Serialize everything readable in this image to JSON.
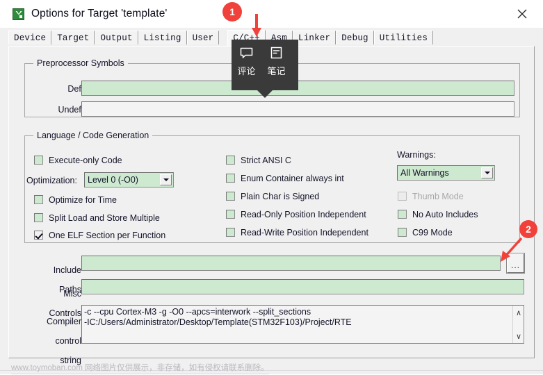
{
  "window": {
    "title": "Options for Target 'template'",
    "app_icon": "keil-uvision-icon",
    "close_label": "✕"
  },
  "tabs": [
    {
      "label": "Device",
      "selected": false
    },
    {
      "label": "Target",
      "selected": false
    },
    {
      "label": "Output",
      "selected": false
    },
    {
      "label": "Listing",
      "selected": false
    },
    {
      "label": "User",
      "selected": false
    },
    {
      "label": "C/C++",
      "selected": true
    },
    {
      "label": "Asm",
      "selected": false
    },
    {
      "label": "Linker",
      "selected": false
    },
    {
      "label": "Debug",
      "selected": false
    },
    {
      "label": "Utilities",
      "selected": false
    }
  ],
  "preprocessor": {
    "group_title": "Preprocessor Symbols",
    "define_label": "Define:",
    "define_value": "",
    "undefine_label": "Undefine:",
    "undefine_value": ""
  },
  "language": {
    "group_title": "Language / Code Generation",
    "left_checks": [
      {
        "label": "Execute-only Code",
        "checked": false,
        "disabled": false
      },
      {
        "label": "Optimize for Time",
        "checked": false,
        "disabled": false
      },
      {
        "label": "Split Load and Store Multiple",
        "checked": false,
        "disabled": false
      },
      {
        "label": "One ELF Section per Function",
        "checked": true,
        "disabled": false
      }
    ],
    "optimization_label": "Optimization:",
    "optimization_value": "Level 0 (-O0)",
    "middle_checks": [
      {
        "label": "Strict ANSI C",
        "checked": false,
        "disabled": false
      },
      {
        "label": "Enum Container always int",
        "checked": false,
        "disabled": false
      },
      {
        "label": "Plain Char is Signed",
        "checked": false,
        "disabled": false
      },
      {
        "label": "Read-Only Position Independent",
        "checked": false,
        "disabled": false
      },
      {
        "label": "Read-Write Position Independent",
        "checked": false,
        "disabled": false
      }
    ],
    "warnings_label": "Warnings:",
    "warnings_value": "All Warnings",
    "right_checks": [
      {
        "label": "Thumb Mode",
        "checked": false,
        "disabled": true
      },
      {
        "label": "No Auto Includes",
        "checked": false,
        "disabled": false
      },
      {
        "label": "C99 Mode",
        "checked": false,
        "disabled": false
      }
    ]
  },
  "bottom": {
    "include_label_line1": "Include",
    "include_label_line2": "Paths",
    "include_value": "",
    "browse_label": "...",
    "misc_label_line1": "Misc",
    "misc_label_line2": "Controls",
    "misc_value": "",
    "compiler_label_line1": "Compiler",
    "compiler_label_line2": "control",
    "compiler_label_line3": "string",
    "compiler_value": "-c --cpu Cortex-M3 -g -O0 --apcs=interwork --split_sections\n-IC:/Users/Administrator/Desktop/Template(STM32F103)/Project/RTE",
    "scroll_up": "∧",
    "scroll_down": "∨"
  },
  "annotations": {
    "badge1": "1",
    "badge2": "2",
    "accent_color": "#f0423a"
  },
  "tooltip": {
    "items": [
      {
        "icon": "comment-bubble-icon",
        "label": "评论"
      },
      {
        "icon": "note-document-icon",
        "label": "笔记"
      }
    ]
  },
  "watermark": {
    "text": "www.toymoban.com 网络图片仅供展示，非存储，如有侵权请联系删除。"
  }
}
